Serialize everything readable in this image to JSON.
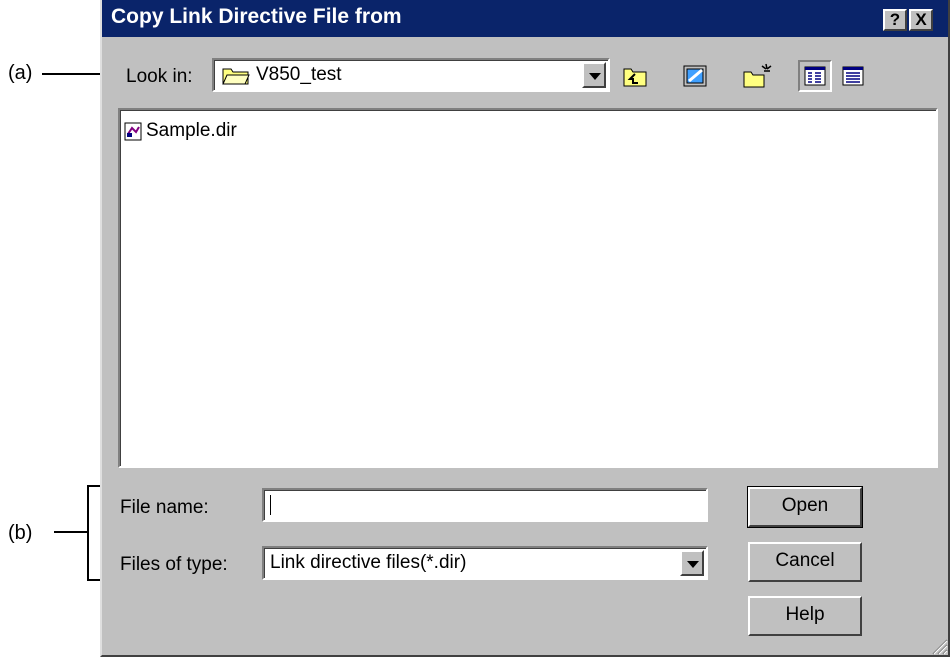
{
  "annotations": {
    "a": "(a)",
    "b": "(b)"
  },
  "dialog": {
    "title": "Copy Link Directive File from",
    "help_button": "?",
    "close_button": "X"
  },
  "look_in": {
    "label": "Look in:",
    "value": "V850_test",
    "icons": [
      "folder-icon",
      "up-one-level-icon",
      "desktop-icon",
      "new-folder-icon",
      "list-view-icon",
      "details-view-icon"
    ]
  },
  "files": [
    {
      "name": "Sample.dir",
      "icon": "directive-file-icon"
    }
  ],
  "file_name": {
    "label": "File name:",
    "value": ""
  },
  "files_of_type": {
    "label": "Files of type:",
    "value": "Link directive files(*.dir)"
  },
  "buttons": {
    "open": "Open",
    "cancel": "Cancel",
    "help": "Help"
  }
}
